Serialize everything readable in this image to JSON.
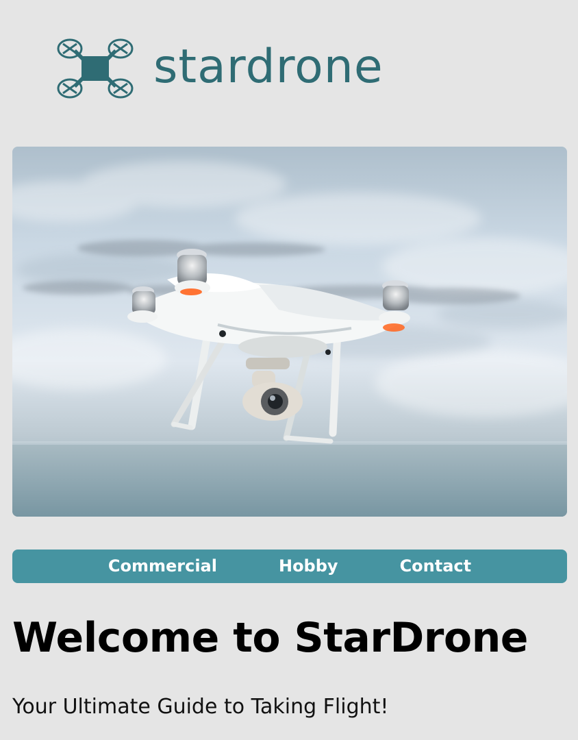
{
  "brand": {
    "name": "stardrone",
    "logo_icon": "quadcopter-icon",
    "color": "#2f6c74"
  },
  "hero": {
    "image": "drone-photo",
    "scene": "white quadcopter drone with camera hovering over sea under cloudy sky"
  },
  "nav": {
    "background": "#4694a1",
    "items": [
      {
        "label": "Commercial"
      },
      {
        "label": "Hobby"
      },
      {
        "label": "Contact"
      }
    ]
  },
  "main": {
    "title": "Welcome to StarDrone",
    "subtitle": "Your Ultimate Guide to Taking Flight!"
  }
}
